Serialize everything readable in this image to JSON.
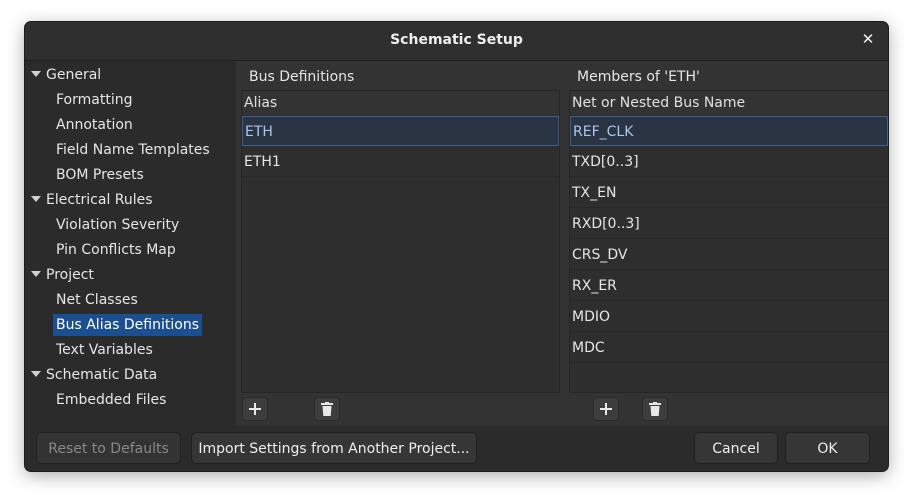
{
  "window": {
    "title": "Schematic Setup"
  },
  "sidebar": {
    "items": [
      {
        "label": "General",
        "type": "group"
      },
      {
        "label": "Formatting",
        "type": "child"
      },
      {
        "label": "Annotation",
        "type": "child"
      },
      {
        "label": "Field Name Templates",
        "type": "child"
      },
      {
        "label": "BOM Presets",
        "type": "child"
      },
      {
        "label": "Electrical Rules",
        "type": "group"
      },
      {
        "label": "Violation Severity",
        "type": "child"
      },
      {
        "label": "Pin Conflicts Map",
        "type": "child"
      },
      {
        "label": "Project",
        "type": "group"
      },
      {
        "label": "Net Classes",
        "type": "child"
      },
      {
        "label": "Bus Alias Definitions",
        "type": "child",
        "selected": true
      },
      {
        "label": "Text Variables",
        "type": "child"
      },
      {
        "label": "Schematic Data",
        "type": "group"
      },
      {
        "label": "Embedded Files",
        "type": "child"
      }
    ]
  },
  "bus_definitions": {
    "label": "Bus Definitions",
    "column_header": "Alias",
    "rows": [
      "ETH",
      "ETH1"
    ],
    "selected_index": 0
  },
  "members": {
    "label": "Members of 'ETH'",
    "column_header": "Net or Nested Bus Name",
    "rows": [
      "REF_CLK",
      "TXD[0..3]",
      "TX_EN",
      "RXD[0..3]",
      "CRS_DV",
      "RX_ER",
      "MDIO",
      "MDC"
    ],
    "selected_index": 0
  },
  "footer": {
    "reset_label": "Reset to Defaults",
    "import_label": "Import Settings from Another Project...",
    "cancel_label": "Cancel",
    "ok_label": "OK"
  },
  "colors": {
    "selection": "#1c4f8f",
    "background": "#2b2b2b"
  }
}
